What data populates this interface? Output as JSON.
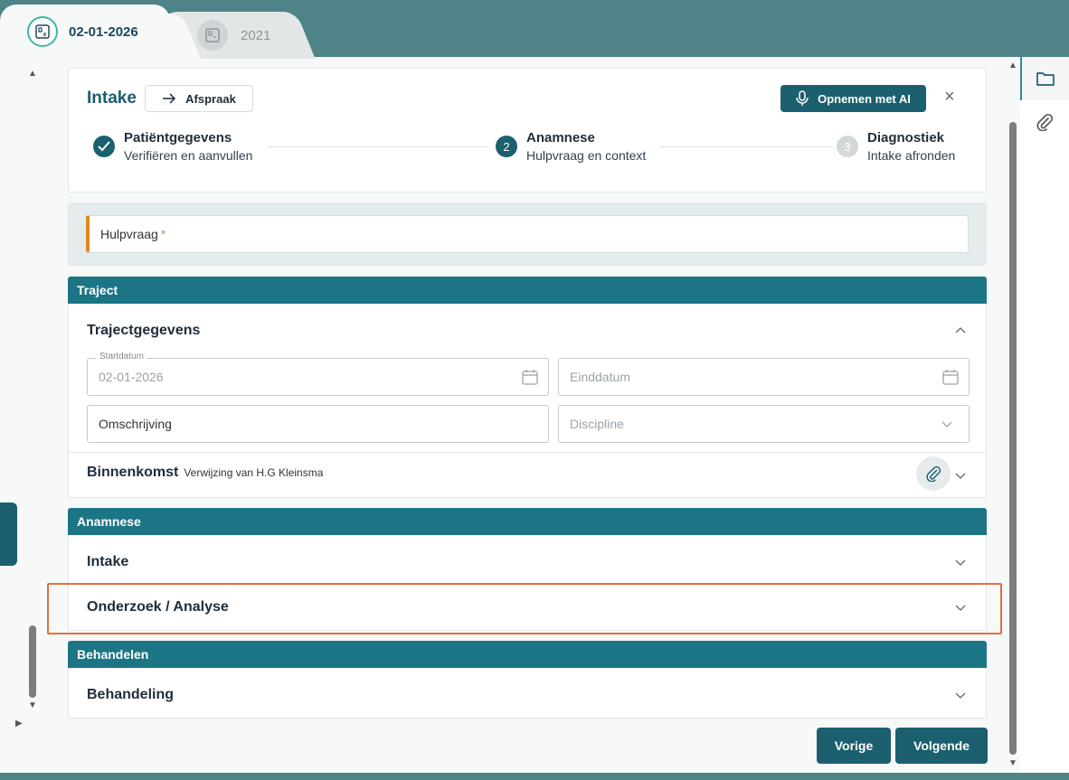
{
  "tabs": [
    {
      "label": "02-01-2026",
      "active": true,
      "icon": "patient-file-icon"
    },
    {
      "label": "2021",
      "active": false,
      "icon": "patient-file-icon"
    }
  ],
  "header": {
    "title": "Intake",
    "appointment_label": "Afspraak",
    "ai_button_label": "Opnemen met AI",
    "close_label": "×"
  },
  "steps": [
    {
      "number": "1",
      "title": "Patiëntgegevens",
      "subtitle": "Verifiëren en aanvullen",
      "state": "done"
    },
    {
      "number": "2",
      "title": "Anamnese",
      "subtitle": "Hulpvraag en context",
      "state": "active"
    },
    {
      "number": "3",
      "title": "Diagnostiek",
      "subtitle": "Intake afronden",
      "state": "pending"
    }
  ],
  "hulpvraag": {
    "label": "Hulpvraag",
    "required_mark": "*"
  },
  "traject": {
    "header": "Traject",
    "section_title": "Trajectgegevens",
    "startdatum": {
      "label": "Startdatum",
      "value": "02-01-2026"
    },
    "einddatum": {
      "placeholder": "Einddatum"
    },
    "omschrijving": {
      "placeholder": "Omschrijving"
    },
    "discipline": {
      "placeholder": "Discipline"
    },
    "binnenkomst": {
      "title": "Binnenkomst",
      "subtitle": "Verwijzing van H.G Kleinsma"
    }
  },
  "anamnese": {
    "header": "Anamnese",
    "items": [
      {
        "label": "Intake"
      },
      {
        "label": "Onderzoek / Analyse"
      }
    ]
  },
  "behandelen": {
    "header": "Behandelen",
    "items": [
      {
        "label": "Behandeling"
      }
    ]
  },
  "footer": {
    "prev_label": "Vorige",
    "next_label": "Volgende"
  },
  "colors": {
    "primary": "#1c5f6e",
    "section": "#1c7585",
    "accent_required": "#e08a1e",
    "highlight": "#e0703a",
    "background": "#4e8487"
  }
}
